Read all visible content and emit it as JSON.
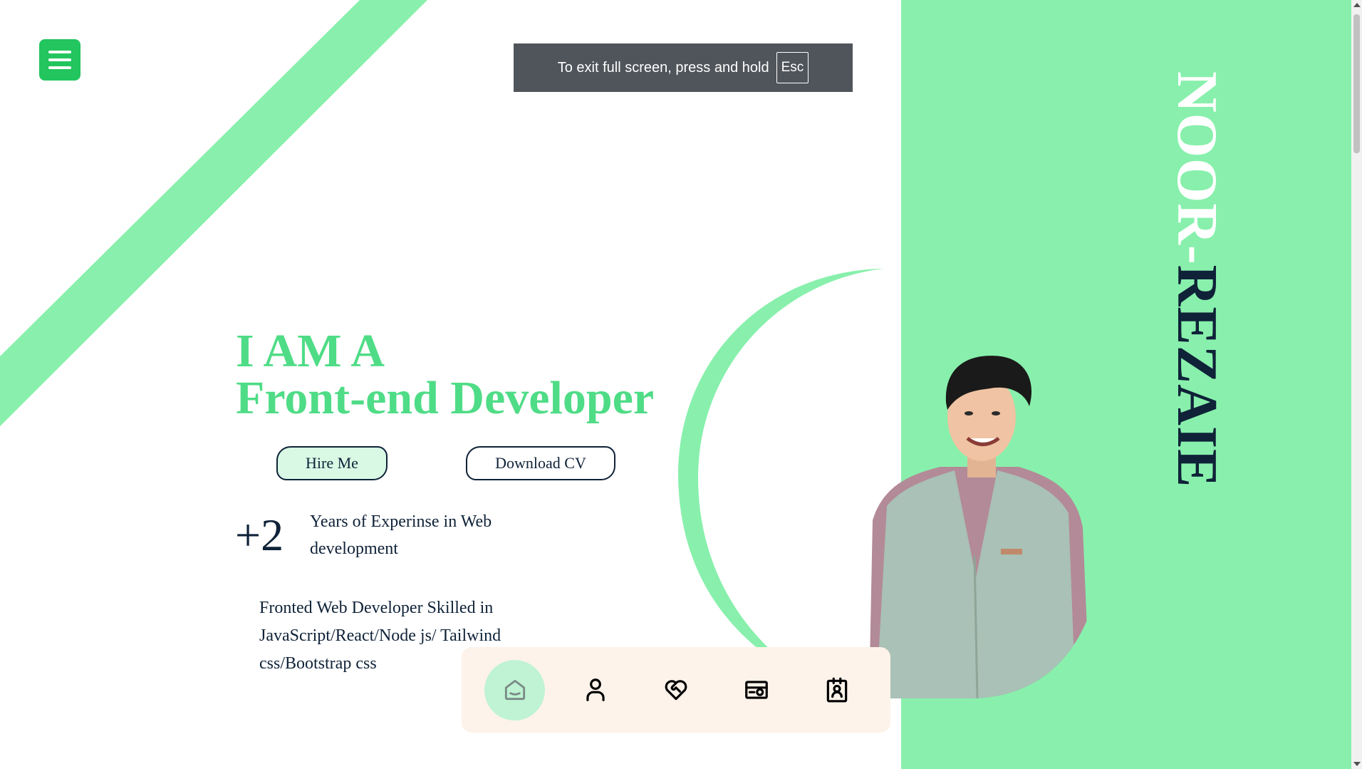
{
  "browser": {
    "fullscreen_toast": {
      "message": "To exit full screen, press and hold",
      "key": "Esc"
    }
  },
  "header": {
    "menu_icon": "hamburger-menu-icon"
  },
  "hero": {
    "line1": "I AM A",
    "line2": "Front-end Developer",
    "hire_button": "Hire Me",
    "cv_button": "Download CV",
    "years_value": "+2",
    "years_text": "Years of Experinse in Web development",
    "bio": "Fronted Web Developer Skilled in JavaScript/React/Node js/ Tailwind css/Bootstrap css"
  },
  "profile": {
    "name_first": "NOOR-",
    "name_last": "REZAIE"
  },
  "bottom_nav": {
    "items": [
      {
        "icon": "home-icon",
        "active": true
      },
      {
        "icon": "user-icon",
        "active": false
      },
      {
        "icon": "heart-handshake-icon",
        "active": false
      },
      {
        "icon": "portfolio-icon",
        "active": false
      },
      {
        "icon": "contact-icon",
        "active": false
      }
    ]
  },
  "colors": {
    "accent_green": "#88f0ac",
    "title_green": "#4fdc86",
    "menu_green": "#22c55e",
    "navy": "#0f2238",
    "nav_bg": "#fdf3ea",
    "nav_active": "#bff3d3"
  }
}
